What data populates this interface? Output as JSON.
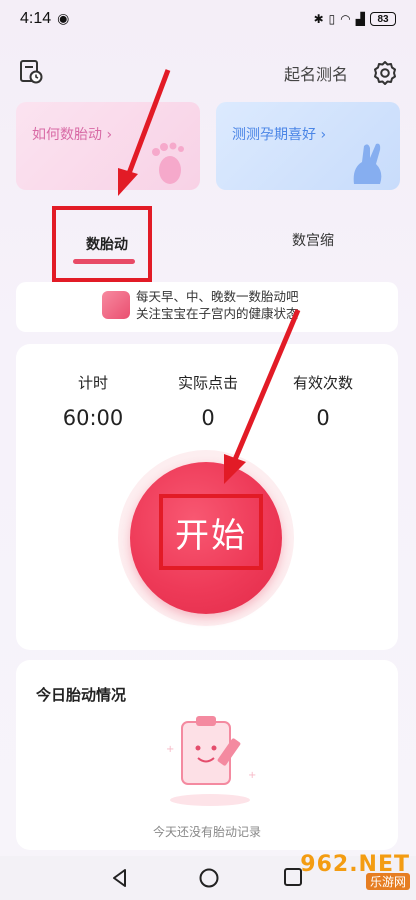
{
  "status_bar": {
    "time": "4:14",
    "battery": "83"
  },
  "header": {
    "name_link": "起名测名"
  },
  "cards": {
    "fetal_guide": "如何数胎动",
    "pregnancy_test": "测测孕期喜好"
  },
  "tabs": {
    "fetal_movement": "数胎动",
    "contraction": "数宫缩"
  },
  "tip": {
    "line1": "每天早、中、晚数一数胎动吧",
    "line2": "关注宝宝在子宫内的健康状态"
  },
  "stats": {
    "timer_label": "计时",
    "timer_value": "60:00",
    "clicks_label": "实际点击",
    "clicks_value": "0",
    "valid_label": "有效次数",
    "valid_value": "0"
  },
  "start_button": "开始",
  "today": {
    "title": "今日胎动情况",
    "empty": "今天还没有胎动记录"
  },
  "watermark": {
    "brand": "962.NET",
    "sub": "乐游网"
  },
  "colors": {
    "accent": "#e84a66",
    "annotation_red": "#e21b26"
  }
}
